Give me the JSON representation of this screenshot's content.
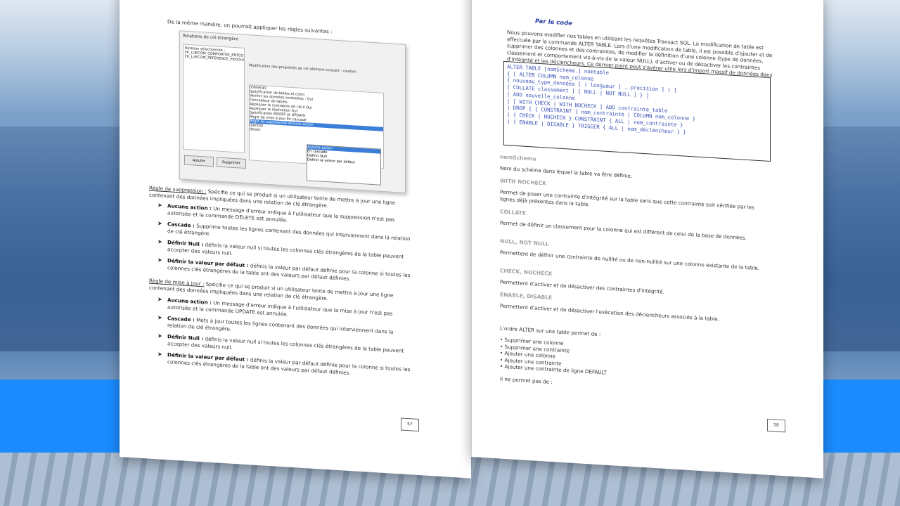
{
  "left_page": {
    "intro": "De la même manière, on pourrait appliquer les règles suivantes :",
    "dialog": {
      "title": "Relations de clé étrangère",
      "list_title": "Relation sélectionnée :",
      "list_items": [
        "FK_LUECOM_COMPORTER_ENTCO",
        "FK_LUECOM_REFERENCE_PRODUI"
      ],
      "description": "Modification des propriétés de cet élément existant : relation.",
      "grid_rows": [
        "(Général)",
        "Spécification de tables et colon",
        "Vérifier les données existantes : Oui",
        "Concepteur de tables",
        "Appliquer la contrainte de clé é Oui",
        "Appliquer la réplication Oui",
        "Spécification INSERT et UPDATE",
        "Règle de mise à jour En cascade",
        "Règle de suppression Aucune action",
        "Identité",
        "(Nom)"
      ],
      "dropdown": [
        "Aucune action",
        "En cascade",
        "Définir Null",
        "Définir la valeur par défaut"
      ],
      "btn_add": "Ajouter",
      "btn_delete": "Supprimer"
    },
    "p1_title": "Règle de suppression :",
    "p1": "Spécifie ce qui se produit si un utilisateur tente de mettre à jour une ligne contenant des données impliquées dans une relation de clé étrangère.",
    "b1_title": "Aucune action :",
    "b1": "Un message d'erreur indique à l'utilisateur que la suppression n'est pas autorisée et la commande DELETE est annulée.",
    "b2_title": "Cascade :",
    "b2": "Supprime toutes les lignes contenant des données qui interviennent dans la relation de clé étrangère.",
    "b3_title": "Définir Null :",
    "b3": "définis la valeur null si toutes les colonnes clés étrangères de la table peuvent accepter des valeurs null.",
    "b4_title": "Définir la valeur par défaut :",
    "b4": "définis la valeur par défaut définie pour la colonne si toutes les colonnes clés étrangères de la table ont des valeurs par défaut définies.",
    "p2_title": "Règle de mise à jour :",
    "p2": "Spécifie ce qui se produit si un utilisateur tente de mettre à jour une ligne contenant des données impliquées dans une relation de clé étrangère.",
    "c1_title": "Aucune action :",
    "c1": "Un message d'erreur indique à l'utilisateur que la mise à jour n'est pas autorisée et la commande UPDATE est annulée.",
    "c2_title": "Cascade :",
    "c2": "Mets à jour toutes les lignes contenant des données qui interviennent dans la relation de clé étrangère.",
    "c3_title": "Définir Null :",
    "c3": "définis la valeur null si toutes les colonnes clés étrangères de la table peuvent accepter des valeurs null.",
    "c4_title": "Définir la valeur par défaut :",
    "c4": "définis la valeur par défaut définie pour la colonne si toutes les colonnes clés étrangères de la table ont des valeurs par défaut définies.",
    "page_number": "57"
  },
  "right_page": {
    "section": "Par le code",
    "intro": "Nous pouvons modifier nos tables en utilisant les requêtes Transact SQL. La modification de table est effectuée par la commande ALTER TABLE. Lors d'une modification de table, il est possible d'ajouter et de supprimer des colonnes et des contraintes, de modifier la définition d'une colonne (type de données, classement et comportement vis-à-vis de la valeur NULL), d'activer ou de désactiver les contraintes d'intégrité et les déclencheurs. Ce dernier point peut s'avérer utile lors d'import massif de données dans la base si l'on souhaite conserver des temps de traitements cohérents.",
    "code": [
      "ALTER TABLE [nomSchema.] nomtable",
      "{ [ ALTER COLUMN nom_colonne",
      "{ nouveau_type_données [ ( longueur [ , precision ] ) ]",
      "[ COLLATE classement ] [ NULL | NOT NULL ] } ]",
      "| ADD nouvelle_colonne",
      "| [ WITH CHECK | WITH NOCHECK ] ADD contrainte_table",
      "| DROP { [ CONSTRAINT ] nom_contrainte | COLUMN nom_colonne }",
      "| { CHECK | NOCHECK } CONSTRAINT { ALL | nom_contrainte }",
      "| { ENABLE | DISABLE } TRIGGER { ALL | nom_déclencheur } }"
    ],
    "terms": [
      {
        "name": "nomSchema",
        "desc": "Nom du schéma dans lequel la table va être définie."
      },
      {
        "name": "WITH NOCHECK",
        "desc": "Permet de poser une contrainte d'intégrité sur la table sans que cette contrainte soit vérifiée par les lignes déjà présentes dans la table."
      },
      {
        "name": "COLLATE",
        "desc": "Permet de définir un classement pour la colonne qui est différent de celui de la base de données."
      },
      {
        "name": "NULL, NOT NULL",
        "desc": "Permettent de définir une contrainte de nullité ou de non-nullité sur une colonne existante de la table."
      },
      {
        "name": "CHECK, NOCHECK",
        "desc": "Permettent d'activer et de désactiver des contraintes d'intégrité."
      },
      {
        "name": "ENABLE, DISABLE",
        "desc": "Permettent d'activer et de désactiver l'exécution des déclencheurs associés à la table."
      }
    ],
    "alter_intro": "L'ordre ALTER sur une table permet de :",
    "alter_list": [
      "Supprimer une colonne",
      "Supprimer une contrainte",
      "Ajouter une colonne",
      "Ajouter une contrainte",
      "Ajouter une contrainte de ligne DEFAULT"
    ],
    "outro": "Il ne permet pas de :",
    "page_number": "58"
  }
}
